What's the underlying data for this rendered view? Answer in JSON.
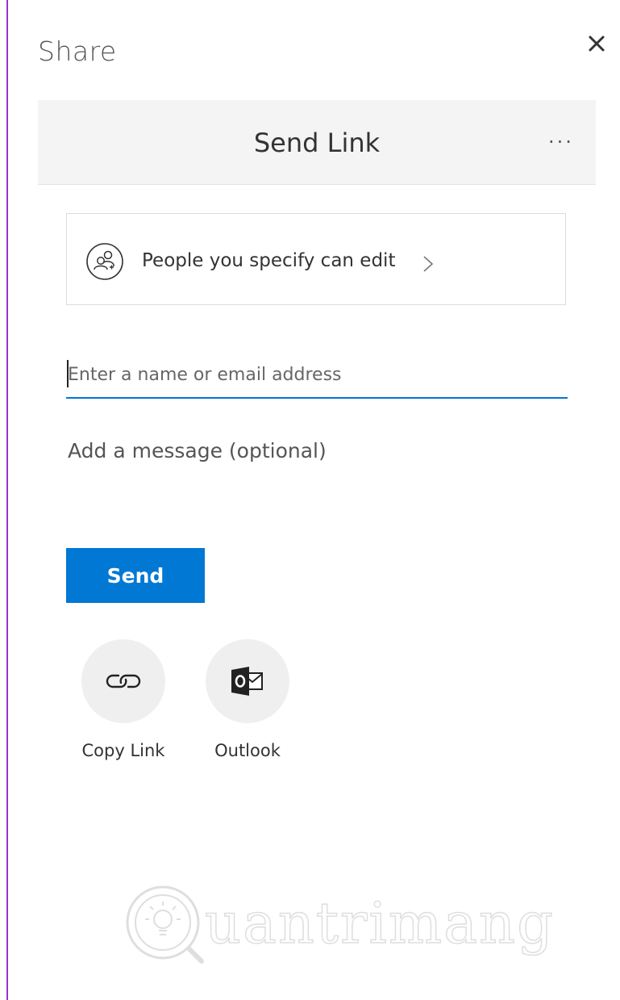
{
  "share_title": "Share",
  "header": {
    "title": "Send Link",
    "more_label": "···"
  },
  "permission": {
    "text": "People you specify can edit"
  },
  "recipient": {
    "placeholder": "Enter a name or email address",
    "value": ""
  },
  "message": {
    "placeholder": "Add a message (optional)"
  },
  "send_label": "Send",
  "share_options": [
    {
      "label": "Copy Link",
      "icon": "link-icon"
    },
    {
      "label": "Outlook",
      "icon": "outlook-icon"
    }
  ],
  "watermark": {
    "text": "uantrimang",
    "logo": "Quantrimang"
  },
  "colors": {
    "accent": "#0078d4",
    "header_bg": "#f4f4f4",
    "frame_border": "#9b30d0"
  }
}
